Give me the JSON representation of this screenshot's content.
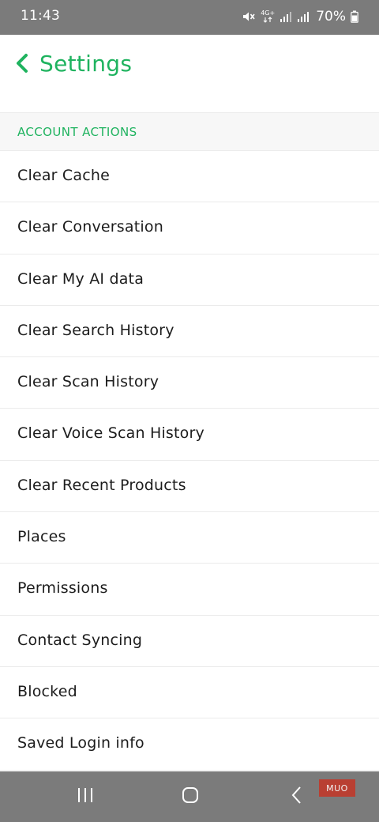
{
  "status_bar": {
    "time": "11:43",
    "network": "4G+",
    "battery": "70%",
    "icons": [
      "mute-icon",
      "network-4g-icon",
      "signal-icon",
      "signal-icon",
      "battery-icon"
    ]
  },
  "header": {
    "title": "Settings",
    "back_icon": "chevron-left-icon",
    "accent_color": "#1fb35f"
  },
  "section": {
    "title": "ACCOUNT ACTIONS"
  },
  "items": [
    {
      "label": "Clear Cache"
    },
    {
      "label": "Clear Conversation"
    },
    {
      "label": "Clear My AI data"
    },
    {
      "label": "Clear Search History"
    },
    {
      "label": "Clear Scan History"
    },
    {
      "label": "Clear Voice Scan History"
    },
    {
      "label": "Clear Recent Products"
    },
    {
      "label": "Places"
    },
    {
      "label": "Permissions"
    },
    {
      "label": "Contact Syncing"
    },
    {
      "label": "Blocked"
    },
    {
      "label": "Saved Login info"
    }
  ],
  "nav_bar": {
    "buttons": [
      "recent-apps-icon",
      "home-icon",
      "back-icon"
    ]
  },
  "watermark": "MUO"
}
